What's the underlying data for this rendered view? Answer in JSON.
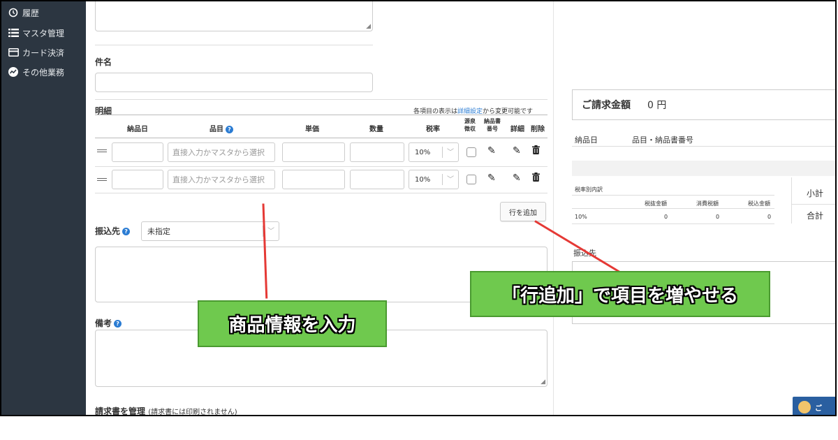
{
  "sidebar": {
    "items": [
      {
        "label": "履歴",
        "icon": "history-icon"
      },
      {
        "label": "マスタ管理",
        "icon": "list-icon"
      },
      {
        "label": "カード決済",
        "icon": "card-icon"
      },
      {
        "label": "その他業務",
        "icon": "chart-icon"
      }
    ]
  },
  "form": {
    "subject_label": "件名",
    "details_label": "明細",
    "details_note_prefix": "各項目の表示は",
    "details_note_link": "詳細設定",
    "details_note_suffix": "から変更可能です",
    "columns": {
      "delivery_date": "納品日",
      "item": "品目",
      "unit_price": "単価",
      "quantity": "数量",
      "tax_rate": "税率",
      "withholding_1": "源泉",
      "withholding_2": "徴収",
      "delivery_no_1": "納品書",
      "delivery_no_2": "番号",
      "detail": "詳細",
      "delete": "削除"
    },
    "rows": [
      {
        "item_placeholder": "直接入力かマスタから選択",
        "tax_rate": "10%"
      },
      {
        "item_placeholder": "直接入力かマスタから選択",
        "tax_rate": "10%"
      }
    ],
    "add_row_button": "行を追加",
    "bank_label": "振込先",
    "bank_value": "未指定",
    "remarks_label": "備考",
    "manage_label": "請求書を管理",
    "manage_note": "(請求書には印刷されません)"
  },
  "preview": {
    "total_label": "ご請求金額",
    "total_value": "0 円",
    "col_date": "納品日",
    "col_item": "品目・納品書番号",
    "tax_breakdown_label": "税率別内訳",
    "tax_cols": {
      "excl": "税抜金額",
      "tax": "消費税額",
      "incl": "税込金額"
    },
    "tax_row": {
      "rate": "10%",
      "excl": "0",
      "tax": "0",
      "incl": "0"
    },
    "subtotal_label": "小計",
    "grand_total_label": "合計",
    "bank_label": "振込先",
    "bottom_badge": "ご"
  },
  "annotations": {
    "product_callout": "商品情報を入力",
    "add_row_callout": "「行追加」で項目を増やせる"
  },
  "colors": {
    "sidebar_bg": "#2c3641",
    "callout_green": "#6fc94e",
    "arrow_red": "#e53935",
    "link_blue": "#2b7cd3"
  }
}
